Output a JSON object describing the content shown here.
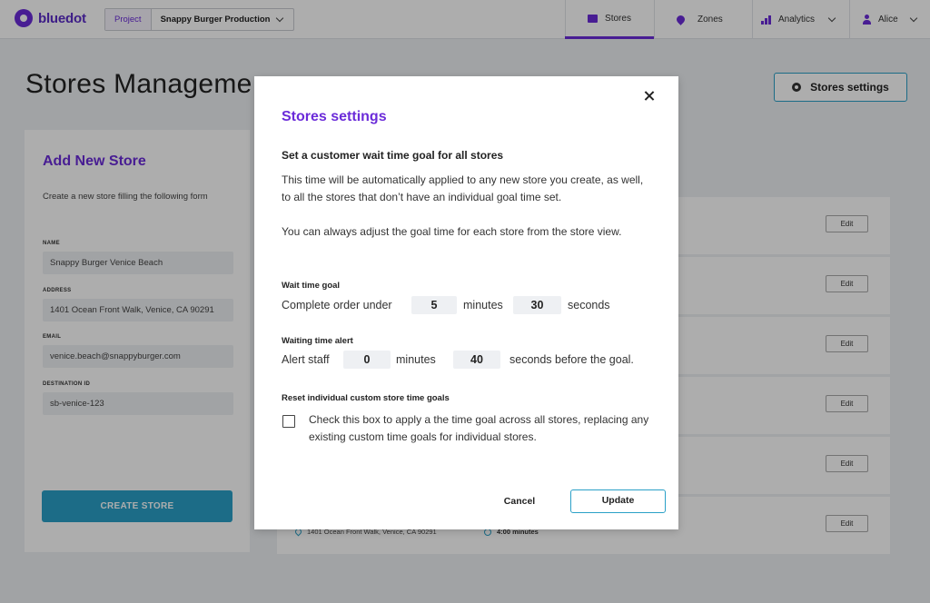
{
  "app": {
    "logo_text": "bluedot",
    "project_label": "Project",
    "project_value": "Snappy Burger Production"
  },
  "nav": {
    "stores": "Stores",
    "zones": "Zones",
    "analytics": "Analytics",
    "user": "Alice"
  },
  "page": {
    "title": "Stores Manageme",
    "settings_button": "Stores settings"
  },
  "add_store": {
    "title": "Add New Store",
    "description": "Create a new store filling the following form",
    "fields": [
      {
        "label": "NAME",
        "value": "Snappy Burger Venice Beach"
      },
      {
        "label": "ADDRESS",
        "value": "1401 Ocean Front Walk, Venice, CA 90291"
      },
      {
        "label": "EMAIL",
        "value": "venice.beach@snappyburger.com"
      },
      {
        "label": "DESTINATION ID",
        "value": "sb-venice-123"
      }
    ],
    "create_button": "CREATE STORE"
  },
  "stores": {
    "edit_label": "Edit",
    "last_row_address": "1401 Ocean Front Walk, Venice, CA 90291",
    "last_row_time": "4:00 minutes"
  },
  "modal": {
    "title": "Stores settings",
    "heading": "Set a customer wait time goal for all stores",
    "paragraph1": "This time will be automatically applied to any new store you create, as well, to all the stores that don’t have an individual goal time set.",
    "paragraph2": "You can always adjust the goal time for each store from the store view.",
    "wait_goal": {
      "label": "Wait time goal",
      "prefix": "Complete order under",
      "minutes_value": "5",
      "minutes_unit": "minutes",
      "seconds_value": "30",
      "seconds_unit": "seconds"
    },
    "alert": {
      "label": "Waiting time alert",
      "prefix": "Alert staff",
      "minutes_value": "0",
      "minutes_unit": "minutes",
      "seconds_value": "40",
      "seconds_suffix": "seconds before the goal."
    },
    "reset": {
      "label": "Reset individual custom store time goals",
      "checkbox_text": "Check this box to apply a the time goal across all stores, replacing any existing custom time goals for individual stores.",
      "checked": false
    },
    "cancel_button": "Cancel",
    "update_button": "Update"
  },
  "colors": {
    "brand": "#6b2bd9",
    "accent": "#2aa0c7"
  },
  "icons": [
    "logo-icon",
    "store-icon",
    "pin-icon",
    "analytics-icon",
    "user-icon",
    "gear-icon",
    "close-icon",
    "chevron-down-icon",
    "clock-icon"
  ]
}
